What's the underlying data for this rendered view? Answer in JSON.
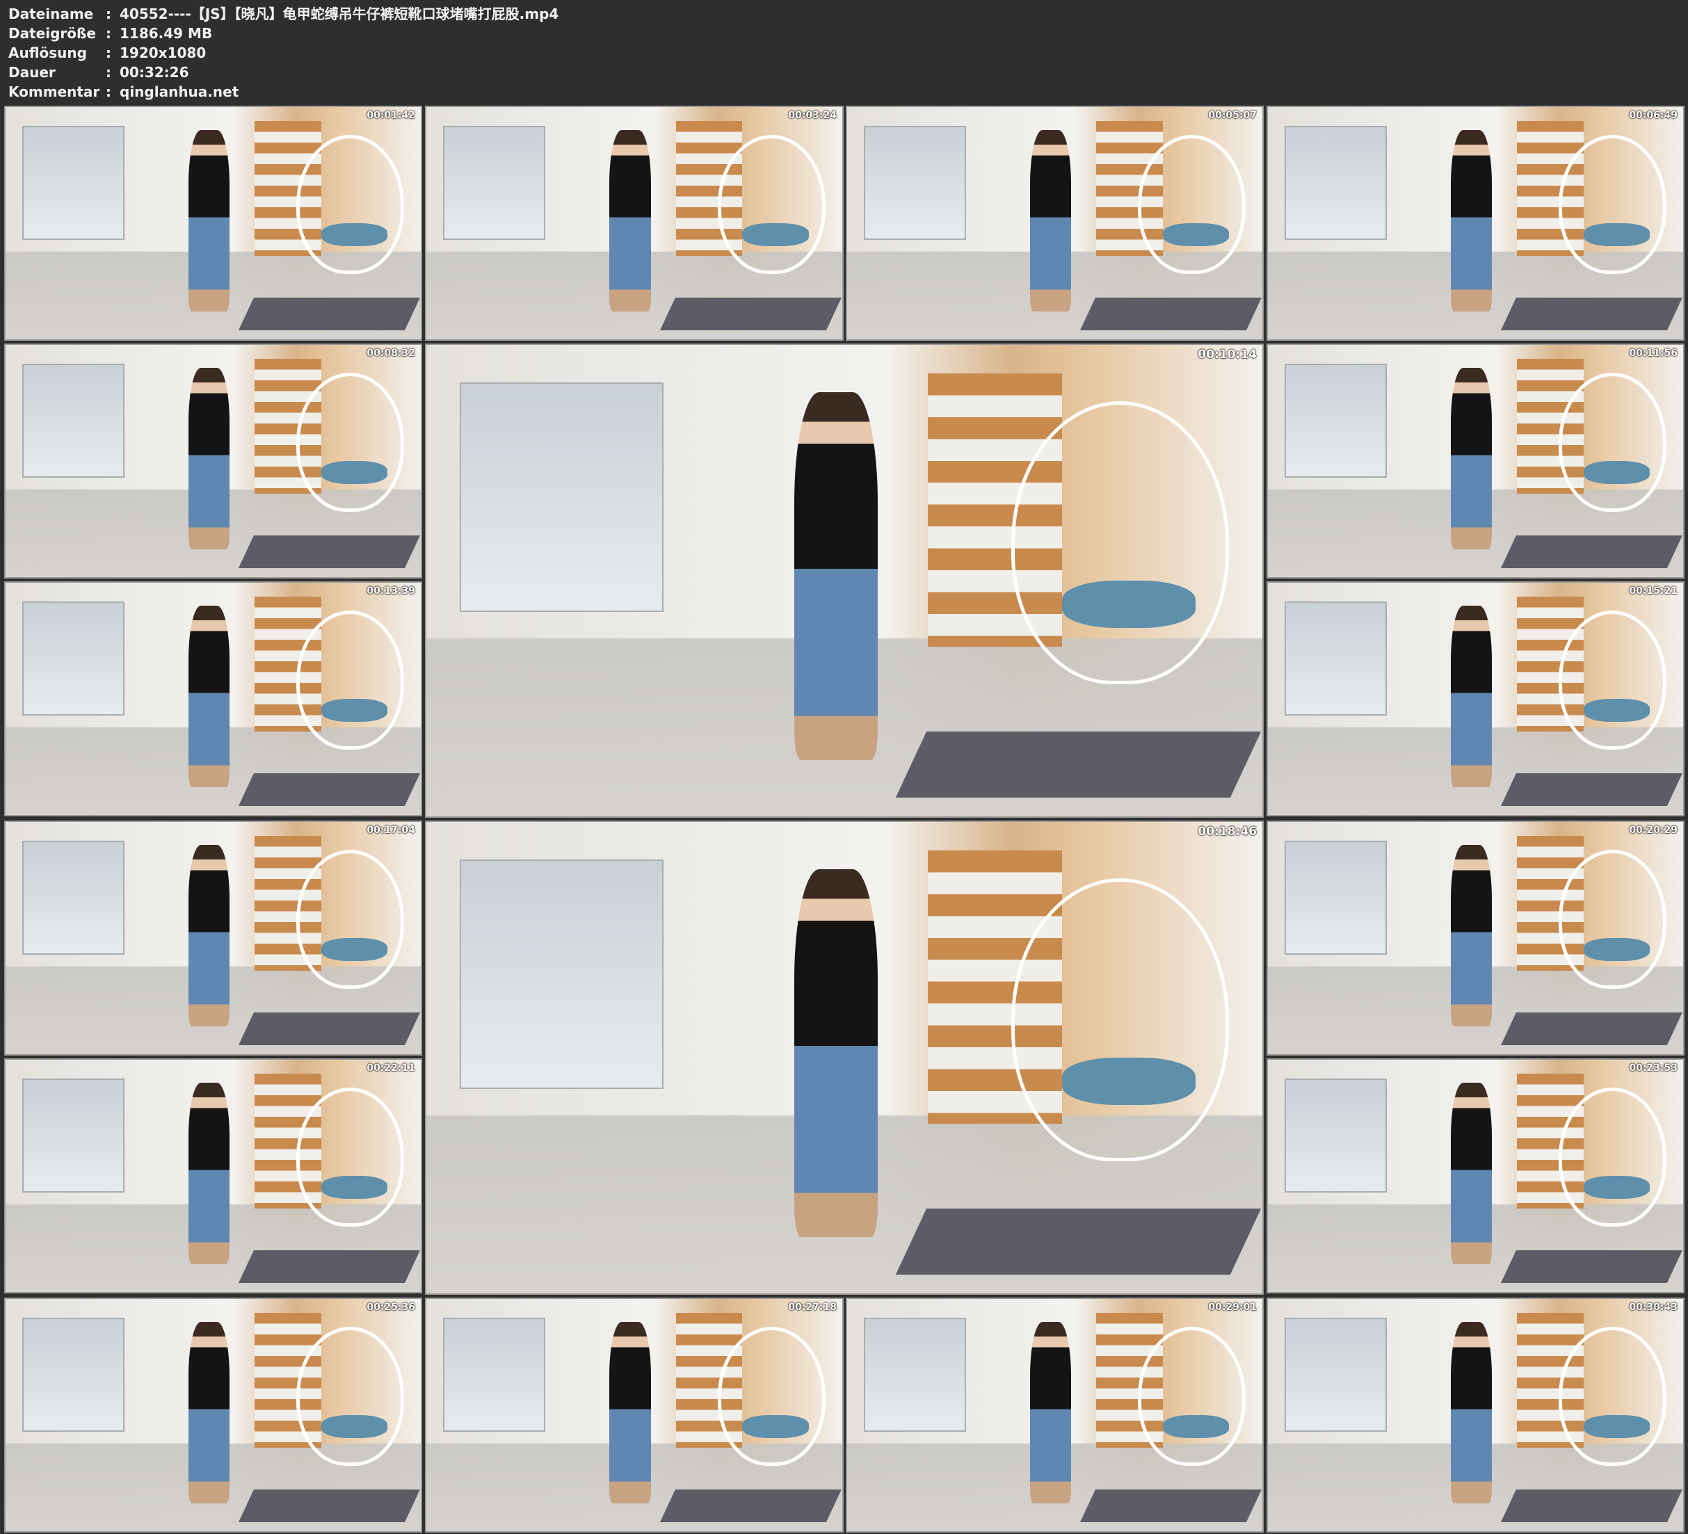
{
  "info": [
    {
      "label": "Dateiname",
      "value": "40552----【JS】【晓凡】龟甲蛇缚吊牛仔裤短靴口球堵嘴打屁股.mp4"
    },
    {
      "label": "Dateigröße",
      "value": "1186.49 MB"
    },
    {
      "label": "Auflösung",
      "value": "1920x1080"
    },
    {
      "label": "Dauer",
      "value": "00:32:26"
    },
    {
      "label": "Kommentar",
      "value": "qinglanhua.net"
    }
  ],
  "separator": ":",
  "thumbnails": [
    {
      "timestamp": "00:01:42"
    },
    {
      "timestamp": "00:03:24"
    },
    {
      "timestamp": "00:05:07"
    },
    {
      "timestamp": "00:06:49"
    },
    {
      "timestamp": "00:08:32"
    },
    {
      "timestamp": "00:10:14"
    },
    {
      "timestamp": "00:11:56"
    },
    {
      "timestamp": "00:13:39"
    },
    {
      "timestamp": "00:15:21"
    },
    {
      "timestamp": "00:17:04"
    },
    {
      "timestamp": "00:18:46"
    },
    {
      "timestamp": "00:20:29"
    },
    {
      "timestamp": "00:22:11"
    },
    {
      "timestamp": "00:23:53"
    },
    {
      "timestamp": "00:25:36"
    },
    {
      "timestamp": "00:27:18"
    },
    {
      "timestamp": "00:29:01"
    },
    {
      "timestamp": "00:30:43"
    }
  ]
}
